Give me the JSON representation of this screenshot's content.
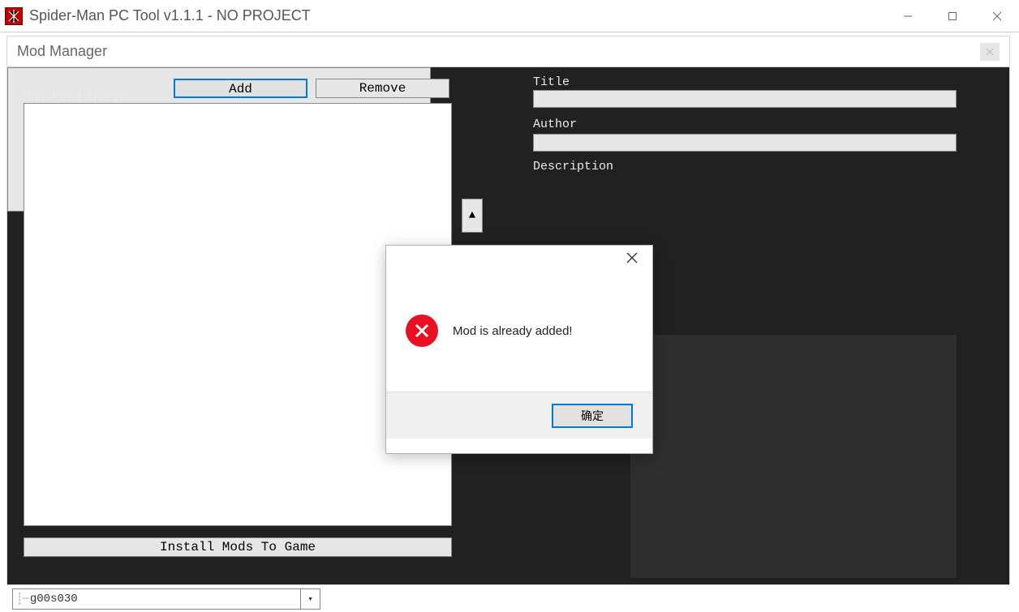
{
  "window": {
    "title": "Spider-Man PC Tool v1.1.1 - NO PROJECT"
  },
  "subwindow": {
    "title": "Mod Manager"
  },
  "labels": {
    "load_order": "Mod Load Order:",
    "title": "Title",
    "author": "Author",
    "description": "Description"
  },
  "buttons": {
    "add": "Add",
    "remove": "Remove",
    "install": "Install Mods To Game"
  },
  "fields": {
    "title_value": "",
    "author_value": "",
    "description_value": ""
  },
  "tree": {
    "item": "g00s030"
  },
  "dialog": {
    "message": "Mod is already added!",
    "ok": "确定"
  }
}
